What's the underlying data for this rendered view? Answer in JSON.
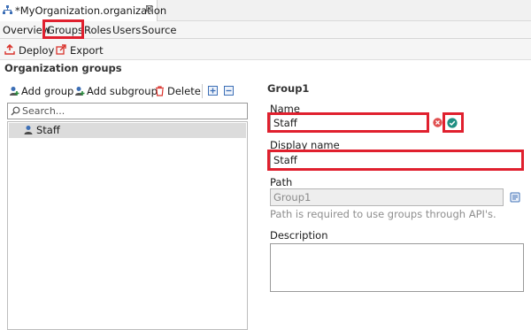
{
  "editor": {
    "tab_title": "*MyOrganization.organization",
    "close_glyph": "⊠"
  },
  "subtabs": [
    "Overview",
    "Groups",
    "Roles",
    "Users",
    "Source"
  ],
  "toolbar": {
    "deploy": "Deploy",
    "export": "Export"
  },
  "section_title": "Organization groups",
  "group_actions": {
    "add_group": "Add group",
    "add_subgroup": "Add subgroup",
    "delete": "Delete"
  },
  "search": {
    "placeholder": "Search..."
  },
  "tree": {
    "items": [
      {
        "label": "Staff"
      }
    ]
  },
  "form": {
    "group_title": "Group1",
    "name_label": "Name",
    "name_value": "Staff",
    "display_name_label": "Display name",
    "display_name_value": "Staff",
    "path_label": "Path",
    "path_value": "Group1",
    "path_hint": "Path is required to use groups through API's.",
    "description_label": "Description",
    "description_value": ""
  },
  "colors": {
    "highlight_red": "#e0202e",
    "validate_teal": "#1f8f83",
    "clear_red": "#e05050",
    "icon_red": "#d9332c",
    "icon_blue": "#3d6fb6"
  }
}
